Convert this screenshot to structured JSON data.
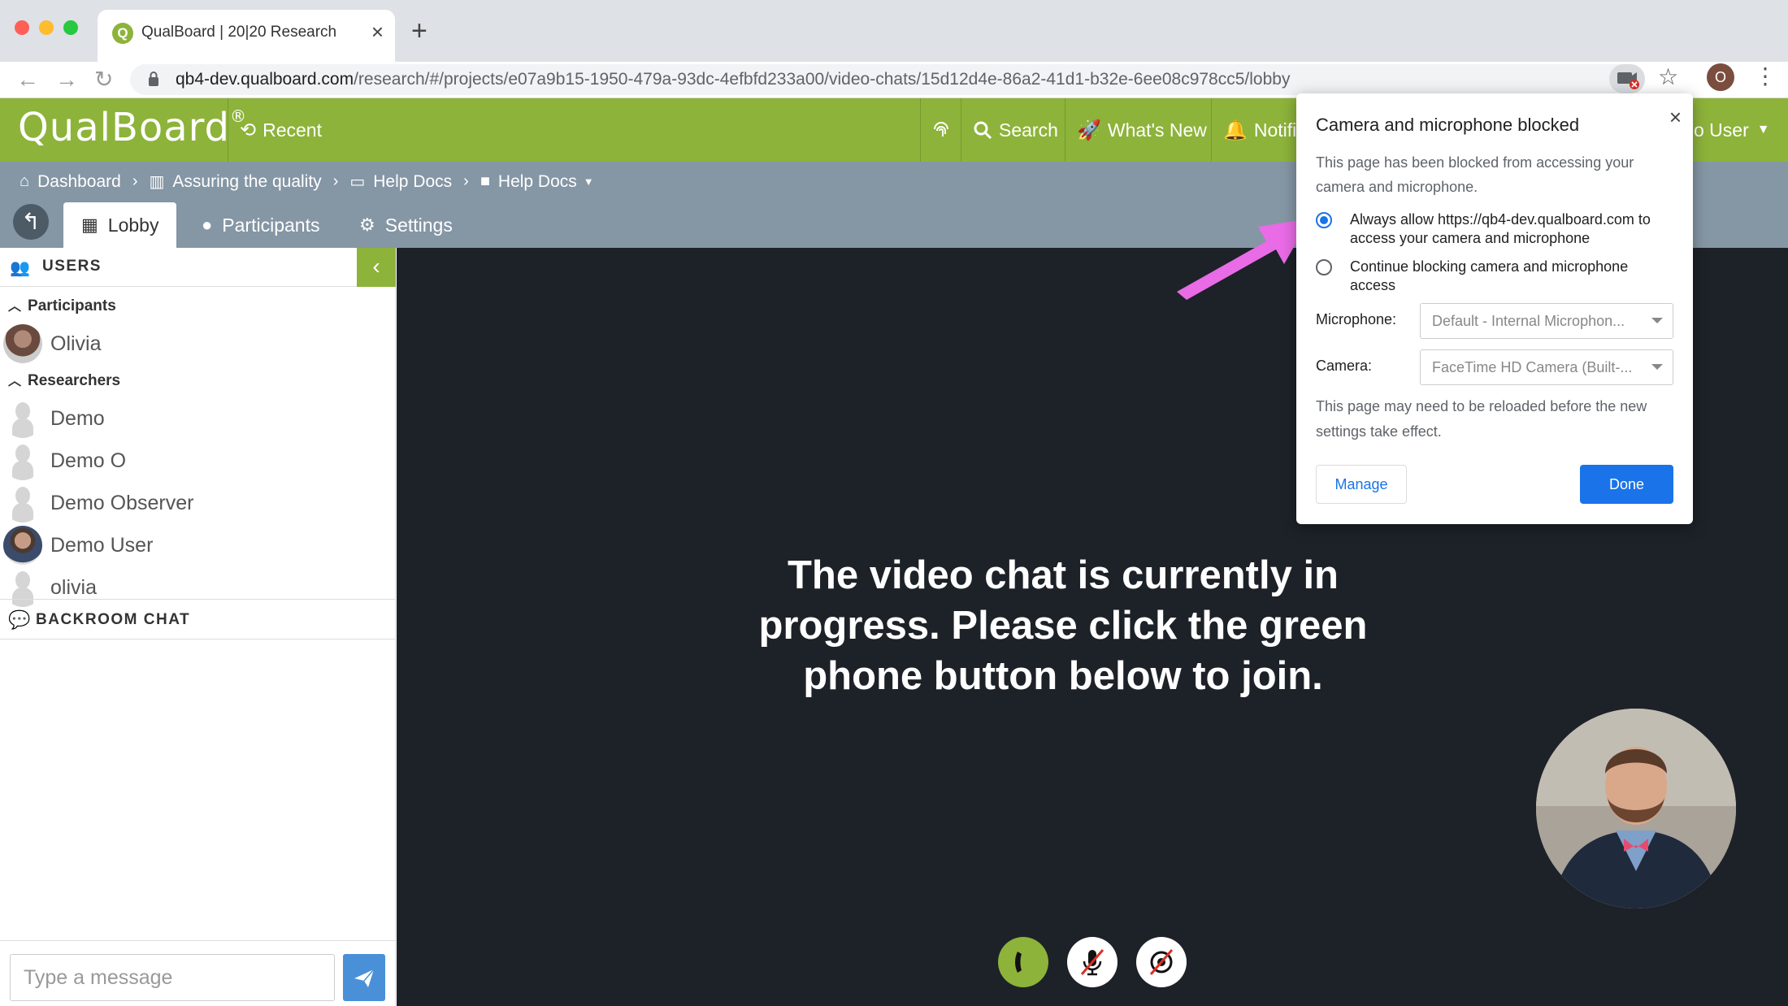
{
  "browser": {
    "tab_title": "QualBoard | 20|20 Research",
    "tab_favicon": "Q",
    "url_host": "qb4-dev.qualboard.com",
    "url_path": "/research/#/projects/e07a9b15-1950-479a-93dc-4efbfd233a00/video-chats/15d12d4e-86a2-41d1-b32e-6ee08c978cc5/lobby",
    "profile_initial": "O"
  },
  "app": {
    "logo": "QualBoard",
    "logo_mark": "®",
    "nav": {
      "recent": "Recent",
      "search": "Search",
      "whats_new": "What's New",
      "notifications": "Notifi",
      "user": "o User"
    },
    "breadcrumbs": [
      "Dashboard",
      "Assuring the quality",
      "Help Docs",
      "Help Docs"
    ],
    "tabs": [
      "Lobby",
      "Participants",
      "Settings"
    ]
  },
  "sidebar": {
    "users_title": "USERS",
    "participants_title": "Participants",
    "participants": [
      "Olivia"
    ],
    "researchers_title": "Researchers",
    "researchers": [
      "Demo",
      "Demo O",
      "Demo Observer",
      "Demo User",
      "olivia"
    ],
    "backroom_title": "BACKROOM CHAT",
    "message_placeholder": "Type a message"
  },
  "video": {
    "message": "The video chat is currently in progress. Please click the green phone button below to join."
  },
  "popup": {
    "title": "Camera and microphone blocked",
    "description": "This page has been blocked from accessing your camera and microphone.",
    "option_allow": "Always allow https://qb4-dev.qualboard.com to access your camera and microphone",
    "option_block": "Continue blocking camera and microphone access",
    "microphone_label": "Microphone:",
    "microphone_value": "Default - Internal Microphon...",
    "camera_label": "Camera:",
    "camera_value": "FaceTime HD Camera (Built-...",
    "note": "This page may need to be reloaded before the new settings take effect.",
    "manage": "Manage",
    "done": "Done"
  },
  "colors": {
    "brand_green": "#8db33a",
    "breadcrumb_band": "#8596a5",
    "video_bg": "#1d2228",
    "primary_blue": "#1a73e8",
    "annotation_arrow": "#e96be6"
  }
}
